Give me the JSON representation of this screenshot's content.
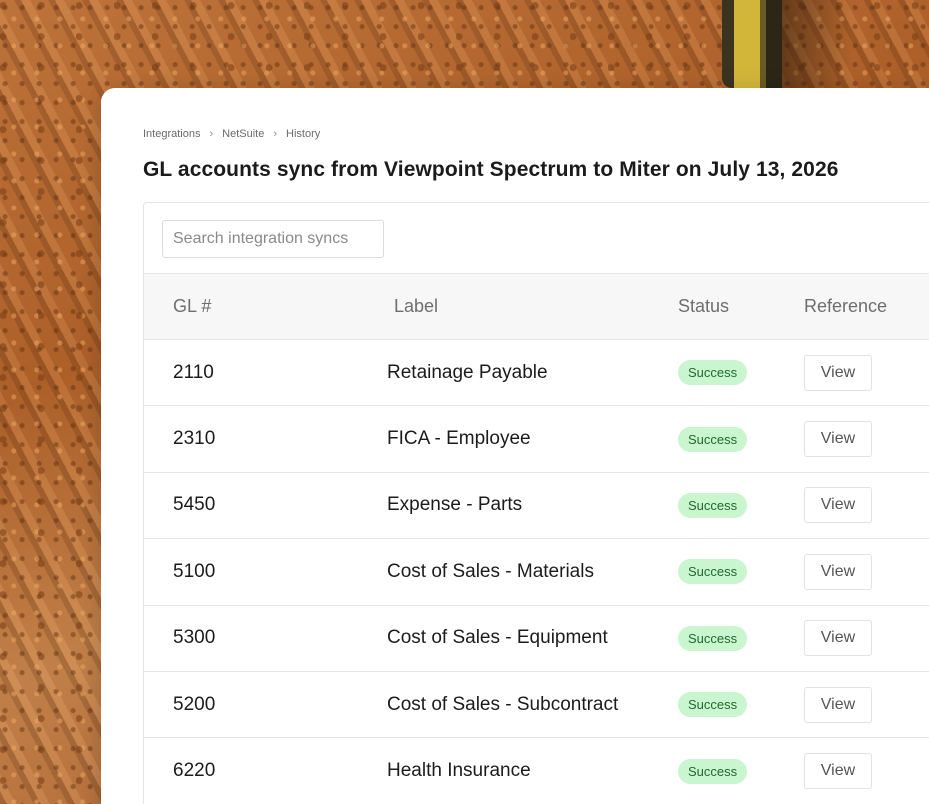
{
  "breadcrumb": [
    "Integrations",
    "NetSuite",
    "History"
  ],
  "title": "GL accounts sync from Viewpoint Spectrum to Miter on July 13, 2026",
  "search": {
    "placeholder": "Search integration syncs",
    "value": ""
  },
  "table": {
    "columns": [
      "GL #",
      "Label",
      "Status",
      "Reference"
    ],
    "rows": [
      {
        "gl": "2110",
        "label": "Retainage Payable",
        "status": "Success",
        "reference": "View"
      },
      {
        "gl": "2310",
        "label": "FICA - Employee",
        "status": "Success",
        "reference": "View"
      },
      {
        "gl": "5450",
        "label": "Expense - Parts",
        "status": "Success",
        "reference": "View"
      },
      {
        "gl": "5100",
        "label": "Cost of Sales - Materials",
        "status": "Success",
        "reference": "View"
      },
      {
        "gl": "5300",
        "label": "Cost of Sales - Equipment",
        "status": "Success",
        "reference": "View"
      },
      {
        "gl": "5200",
        "label": "Cost of Sales - Subcontract",
        "status": "Success",
        "reference": "View"
      },
      {
        "gl": "6220",
        "label": "Health Insurance",
        "status": "Success",
        "reference": "View"
      }
    ]
  },
  "colors": {
    "success_bg": "#c9f5cf",
    "success_text": "#1f6b2d"
  },
  "icons": {
    "breadcrumb_separator": "chevron-right-icon"
  }
}
